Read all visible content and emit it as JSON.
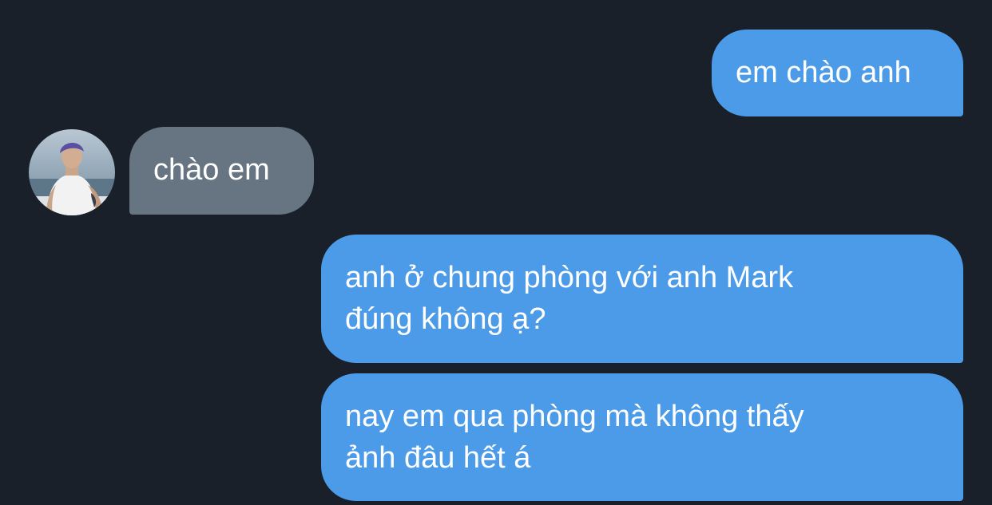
{
  "messages": [
    {
      "direction": "outgoing",
      "text": "em chào anh"
    },
    {
      "direction": "incoming",
      "text": "chào em",
      "avatar": "contact-avatar-photo"
    },
    {
      "direction": "outgoing",
      "text": "anh ở chung phòng với anh Mark\nđúng không ạ?"
    },
    {
      "direction": "outgoing",
      "text": "nay em qua phòng mà không thấy\nảnh đâu hết á"
    }
  ],
  "colors": {
    "background": "#19202a",
    "outgoing_bubble": "#4c9be8",
    "incoming_bubble": "#677582",
    "text": "#ffffff"
  }
}
